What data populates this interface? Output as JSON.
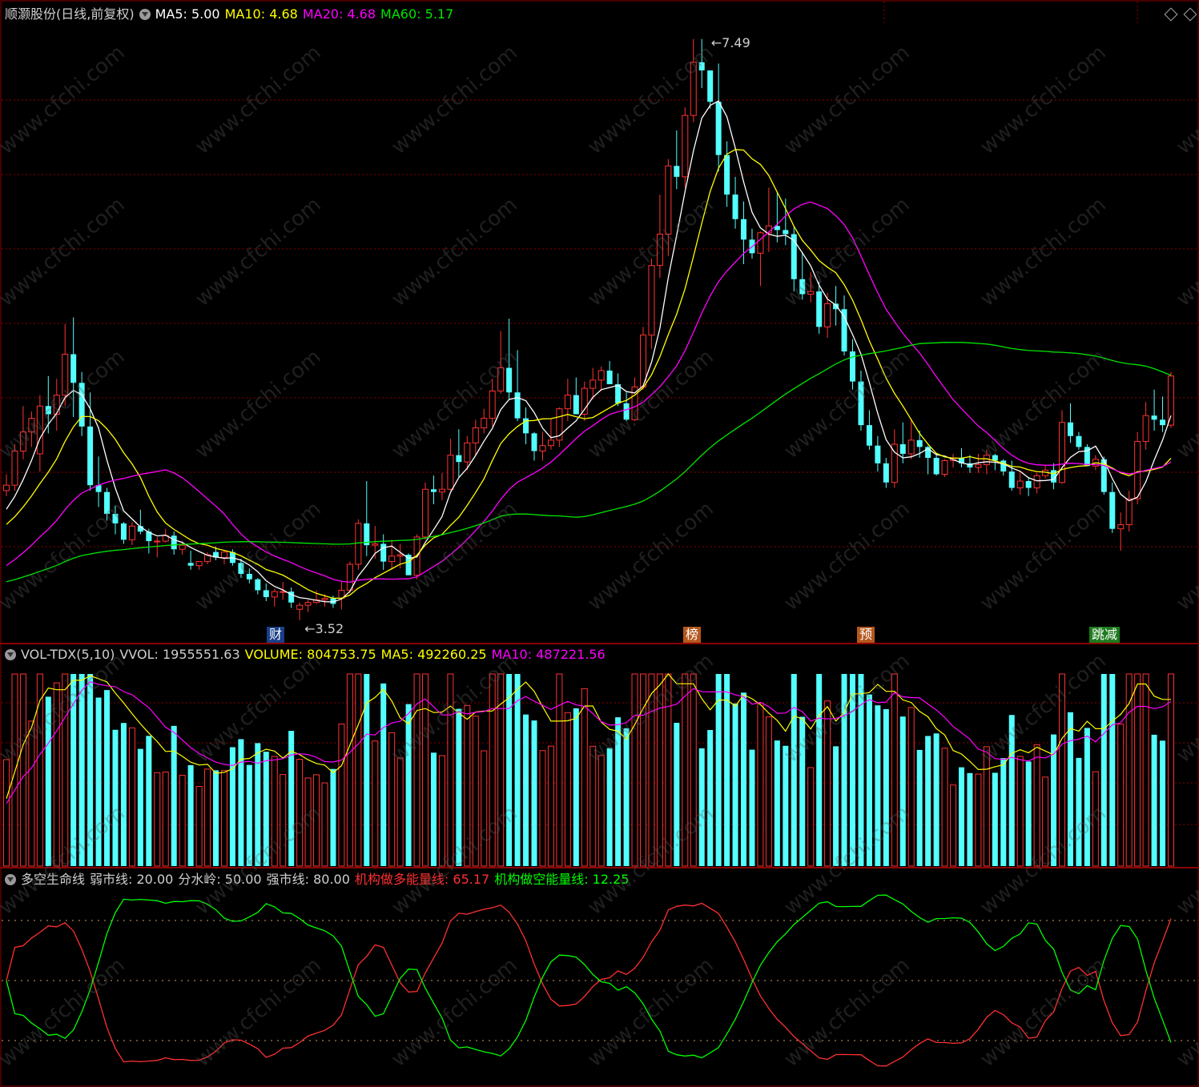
{
  "colors": {
    "up": "#ff3232",
    "down": "#54ffff",
    "ma5": "#ffffff",
    "ma10": "#ffff00",
    "ma20": "#ff00ff",
    "ma60": "#00e600",
    "grid": "#8b0000",
    "yellow": "#ffff00",
    "red": "#ff3030",
    "green": "#00ff00"
  },
  "header": {
    "title": "顺灏股份(日线,前复权)",
    "ma5": "MA5: 5.00",
    "ma10": "MA10: 4.68",
    "ma20": "MA20: 4.68",
    "ma60": "MA60: 5.17"
  },
  "vol_header": {
    "name": "VOL-TDX(5,10)",
    "vvol": "VVOL: 1955551.63",
    "volume": "VOLUME: 804753.75",
    "ma5": "MA5: 492260.25",
    "ma10": "MA10: 487221.56"
  },
  "ind_header": {
    "name": "多空生命线",
    "weak": "弱市线: 20.00",
    "mid": "分水岭: 50.00",
    "strong": "强市线: 80.00",
    "bull": "机构做多能量线: 65.17",
    "bear": "机构做空能量线: 12.25"
  },
  "annotations": {
    "high": "7.49",
    "low": "3.52"
  },
  "event_tags": [
    "财",
    "榜",
    "预",
    "跳减"
  ],
  "watermark": "www.cfchi.com",
  "chart_data": [
    {
      "type": "candlestick",
      "name": "price",
      "ohlc": [
        [
          4.18,
          4.3,
          4.14,
          4.22
        ],
        [
          4.22,
          4.52,
          4.18,
          4.47
        ],
        [
          4.47,
          4.8,
          4.41,
          4.61
        ],
        [
          4.61,
          4.76,
          4.5,
          4.71
        ],
        [
          4.45,
          4.88,
          4.32,
          4.8
        ],
        [
          4.8,
          5.02,
          4.6,
          4.74
        ],
        [
          4.74,
          5.0,
          4.62,
          4.88
        ],
        [
          4.88,
          5.4,
          4.8,
          5.18
        ],
        [
          5.18,
          5.45,
          4.72,
          4.97
        ],
        [
          4.97,
          5.05,
          4.58,
          4.65
        ],
        [
          4.65,
          4.9,
          4.18,
          4.22
        ],
        [
          4.22,
          4.43,
          4.06,
          4.17
        ],
        [
          4.17,
          4.2,
          3.96,
          4.01
        ],
        [
          4.01,
          4.07,
          3.86,
          3.94
        ],
        [
          3.94,
          3.95,
          3.79,
          3.82
        ],
        [
          3.82,
          3.95,
          3.78,
          3.92
        ],
        [
          3.92,
          4.04,
          3.86,
          3.88
        ],
        [
          3.88,
          3.9,
          3.72,
          3.81
        ],
        [
          3.81,
          3.84,
          3.69,
          3.81
        ],
        [
          3.81,
          3.9,
          3.8,
          3.85
        ],
        [
          3.85,
          3.88,
          3.71,
          3.75
        ],
        [
          3.75,
          3.81,
          3.71,
          3.78
        ],
        [
          3.65,
          3.74,
          3.6,
          3.63
        ],
        [
          3.63,
          3.66,
          3.6,
          3.66
        ],
        [
          3.66,
          3.73,
          3.64,
          3.71
        ],
        [
          3.73,
          3.77,
          3.67,
          3.69
        ],
        [
          3.69,
          3.74,
          3.64,
          3.73
        ],
        [
          3.73,
          3.75,
          3.63,
          3.65
        ],
        [
          3.65,
          3.68,
          3.54,
          3.57
        ],
        [
          3.57,
          3.61,
          3.5,
          3.53
        ],
        [
          3.53,
          3.54,
          3.42,
          3.45
        ],
        [
          3.45,
          3.5,
          3.37,
          3.4
        ],
        [
          3.4,
          3.46,
          3.33,
          3.44
        ],
        [
          3.44,
          3.51,
          3.38,
          3.44
        ],
        [
          3.44,
          3.47,
          3.32,
          3.36
        ],
        [
          3.31,
          3.36,
          3.23,
          3.34
        ],
        [
          3.34,
          3.38,
          3.29,
          3.36
        ],
        [
          3.36,
          3.45,
          3.35,
          3.38
        ],
        [
          3.38,
          3.42,
          3.33,
          3.39
        ],
        [
          3.39,
          3.41,
          3.32,
          3.35
        ],
        [
          3.39,
          3.51,
          3.31,
          3.45
        ],
        [
          3.45,
          3.66,
          3.43,
          3.64
        ],
        [
          3.64,
          3.97,
          3.6,
          3.94
        ],
        [
          3.94,
          4.25,
          3.7,
          3.78
        ],
        [
          3.78,
          3.92,
          3.68,
          3.79
        ],
        [
          3.79,
          3.86,
          3.6,
          3.66
        ],
        [
          3.66,
          3.82,
          3.6,
          3.7
        ],
        [
          3.7,
          3.79,
          3.61,
          3.71
        ],
        [
          3.71,
          3.72,
          3.56,
          3.56
        ],
        [
          3.56,
          3.86,
          3.53,
          3.84
        ],
        [
          3.84,
          4.24,
          3.82,
          4.19
        ],
        [
          4.19,
          4.29,
          4.08,
          4.17
        ],
        [
          4.17,
          4.31,
          4.11,
          4.19
        ],
        [
          4.19,
          4.56,
          4.18,
          4.44
        ],
        [
          4.44,
          4.63,
          4.28,
          4.39
        ],
        [
          4.39,
          4.58,
          4.33,
          4.53
        ],
        [
          4.53,
          4.7,
          4.44,
          4.64
        ],
        [
          4.64,
          4.78,
          4.6,
          4.71
        ],
        [
          4.71,
          5.0,
          4.65,
          4.91
        ],
        [
          4.91,
          5.35,
          4.89,
          5.08
        ],
        [
          5.08,
          5.44,
          4.85,
          4.9
        ],
        [
          4.9,
          5.21,
          4.69,
          4.71
        ],
        [
          4.71,
          4.79,
          4.52,
          4.6
        ],
        [
          4.6,
          4.61,
          4.4,
          4.47
        ],
        [
          4.47,
          4.61,
          4.4,
          4.51
        ],
        [
          4.51,
          4.71,
          4.48,
          4.55
        ],
        [
          4.55,
          4.79,
          4.5,
          4.78
        ],
        [
          4.78,
          5.0,
          4.69,
          4.88
        ],
        [
          4.88,
          5.01,
          4.74,
          4.74
        ],
        [
          4.74,
          4.98,
          4.69,
          4.93
        ],
        [
          4.93,
          5.08,
          4.85,
          4.99
        ],
        [
          4.99,
          5.09,
          4.91,
          5.06
        ],
        [
          5.06,
          5.13,
          4.96,
          4.96
        ],
        [
          4.96,
          5.04,
          4.8,
          4.82
        ],
        [
          4.82,
          4.9,
          4.69,
          4.7
        ],
        [
          4.7,
          5.01,
          4.69,
          4.94
        ],
        [
          4.94,
          5.38,
          4.92,
          5.32
        ],
        [
          5.32,
          5.88,
          5.22,
          5.83
        ],
        [
          5.83,
          6.35,
          5.74,
          6.06
        ],
        [
          6.06,
          6.61,
          5.9,
          6.56
        ],
        [
          6.56,
          6.82,
          6.39,
          6.48
        ],
        [
          6.48,
          6.99,
          6.4,
          6.93
        ],
        [
          6.93,
          7.49,
          6.88,
          7.32
        ],
        [
          7.32,
          7.49,
          7.13,
          7.26
        ],
        [
          7.26,
          7.22,
          6.98,
          7.03
        ],
        [
          7.03,
          7.31,
          6.52,
          6.64
        ],
        [
          6.64,
          6.74,
          6.26,
          6.35
        ],
        [
          6.35,
          6.48,
          6.1,
          6.17
        ],
        [
          6.17,
          6.3,
          5.84,
          6.02
        ],
        [
          6.02,
          6.1,
          5.88,
          5.92
        ],
        [
          5.92,
          6.08,
          5.68,
          6.07
        ],
        [
          6.07,
          6.4,
          5.93,
          6.12
        ],
        [
          6.12,
          6.37,
          6.0,
          6.09
        ],
        [
          6.09,
          6.32,
          5.98,
          6.06
        ],
        [
          6.06,
          6.12,
          5.64,
          5.73
        ],
        [
          5.73,
          5.93,
          5.58,
          5.62
        ],
        [
          5.62,
          5.78,
          5.56,
          5.64
        ],
        [
          5.64,
          5.71,
          5.33,
          5.38
        ],
        [
          5.38,
          5.63,
          5.3,
          5.55
        ],
        [
          5.55,
          5.68,
          5.39,
          5.51
        ],
        [
          5.51,
          5.61,
          5.17,
          5.2
        ],
        [
          5.2,
          5.29,
          4.92,
          4.98
        ],
        [
          4.98,
          5.06,
          4.62,
          4.66
        ],
        [
          4.66,
          4.77,
          4.48,
          4.51
        ],
        [
          4.51,
          4.58,
          4.32,
          4.38
        ],
        [
          4.38,
          4.42,
          4.2,
          4.24
        ],
        [
          4.24,
          4.63,
          4.2,
          4.52
        ],
        [
          4.52,
          4.68,
          4.38,
          4.45
        ],
        [
          4.45,
          4.71,
          4.41,
          4.55
        ],
        [
          4.55,
          4.62,
          4.42,
          4.5
        ],
        [
          4.5,
          4.51,
          4.3,
          4.42
        ],
        [
          4.42,
          4.45,
          4.29,
          4.3
        ],
        [
          4.3,
          4.41,
          4.28,
          4.4
        ],
        [
          4.4,
          4.45,
          4.35,
          4.42
        ],
        [
          4.42,
          4.49,
          4.35,
          4.38
        ],
        [
          4.38,
          4.44,
          4.31,
          4.35
        ],
        [
          4.35,
          4.45,
          4.31,
          4.37
        ],
        [
          4.37,
          4.48,
          4.3,
          4.44
        ],
        [
          4.44,
          4.45,
          4.33,
          4.4
        ],
        [
          4.4,
          4.41,
          4.29,
          4.32
        ],
        [
          4.32,
          4.4,
          4.18,
          4.2
        ],
        [
          4.2,
          4.31,
          4.15,
          4.25
        ],
        [
          4.25,
          4.28,
          4.14,
          4.2
        ],
        [
          4.2,
          4.31,
          4.16,
          4.29
        ],
        [
          4.29,
          4.37,
          4.27,
          4.33
        ],
        [
          4.33,
          4.38,
          4.19,
          4.24
        ],
        [
          4.24,
          4.77,
          4.23,
          4.68
        ],
        [
          4.68,
          4.82,
          4.53,
          4.58
        ],
        [
          4.58,
          4.61,
          4.48,
          4.5
        ],
        [
          4.5,
          4.52,
          4.36,
          4.36
        ],
        [
          4.36,
          4.44,
          4.33,
          4.41
        ],
        [
          4.41,
          4.43,
          4.15,
          4.17
        ],
        [
          4.17,
          4.24,
          3.87,
          3.9
        ],
        [
          3.9,
          4.02,
          3.74,
          3.93
        ],
        [
          3.93,
          4.18,
          3.88,
          4.12
        ],
        [
          4.12,
          4.61,
          4.08,
          4.54
        ],
        [
          4.54,
          4.83,
          4.48,
          4.73
        ],
        [
          4.73,
          4.92,
          4.62,
          4.7
        ],
        [
          4.7,
          4.87,
          4.61,
          4.66
        ],
        [
          4.66,
          5.05,
          4.64,
          5.02
        ]
      ],
      "high_label": "7.49",
      "low_label": "3.52"
    },
    {
      "type": "bar",
      "name": "VOL-TDX",
      "series_from": "price"
    },
    {
      "type": "line",
      "name": "多空生命线",
      "levels": [
        20,
        50,
        80
      ]
    }
  ]
}
